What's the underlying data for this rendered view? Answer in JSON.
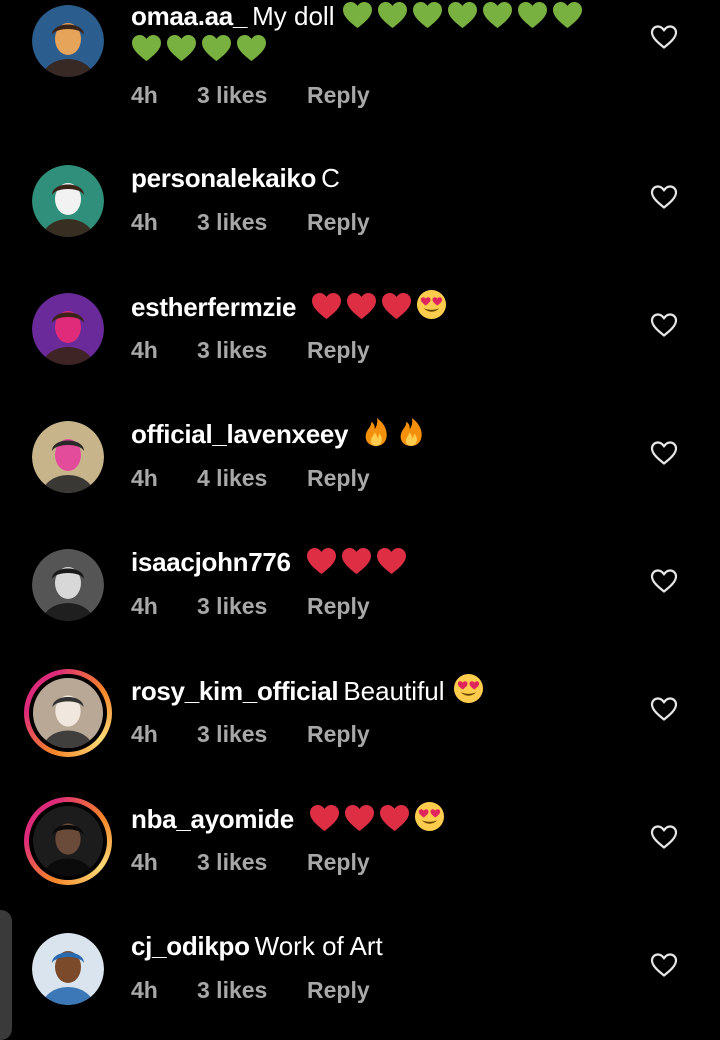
{
  "comments": [
    {
      "username": "omaa.aa_",
      "text": "My doll",
      "emojis": [
        "green-heart",
        "green-heart",
        "green-heart",
        "green-heart",
        "green-heart",
        "green-heart",
        "green-heart",
        "green-heart",
        "green-heart",
        "green-heart",
        "green-heart"
      ],
      "time": "4h",
      "likes": "3 likes",
      "reply": "Reply",
      "story_ring": false,
      "avatar_colors": [
        "#2c5d8f",
        "#e6a45a",
        "#3a2418"
      ]
    },
    {
      "username": "personalekaiko",
      "text": "C",
      "emojis": [],
      "time": "4h",
      "likes": "3 likes",
      "reply": "Reply",
      "story_ring": false,
      "avatar_colors": [
        "#2f8f7a",
        "#f2f2f2",
        "#3a2418"
      ]
    },
    {
      "username": "estherfermzie",
      "text": "",
      "emojis": [
        "red-heart",
        "red-heart",
        "red-heart",
        "heart-eyes-face"
      ],
      "time": "4h",
      "likes": "3 likes",
      "reply": "Reply",
      "story_ring": false,
      "avatar_colors": [
        "#6a2a9a",
        "#e02b7a",
        "#3a2418"
      ]
    },
    {
      "username": "official_lavenxeey",
      "text": "",
      "emojis": [
        "fire",
        "fire"
      ],
      "time": "4h",
      "likes": "4 likes",
      "reply": "Reply",
      "story_ring": false,
      "avatar_colors": [
        "#c8b48a",
        "#e24c9a",
        "#2a2a2a"
      ]
    },
    {
      "username": "isaacjohn776",
      "text": "",
      "emojis": [
        "red-heart",
        "red-heart",
        "red-heart"
      ],
      "time": "4h",
      "likes": "3 likes",
      "reply": "Reply",
      "story_ring": false,
      "avatar_colors": [
        "#555555",
        "#d8d8d8",
        "#1a1a1a"
      ]
    },
    {
      "username": "rosy_kim_official",
      "text": "Beautiful",
      "emojis": [
        "heart-eyes-face"
      ],
      "time": "4h",
      "likes": "3 likes",
      "reply": "Reply",
      "story_ring": true,
      "avatar_colors": [
        "#b9a896",
        "#f0e8de",
        "#333333"
      ]
    },
    {
      "username": "nba_ayomide",
      "text": "",
      "emojis": [
        "red-heart",
        "red-heart",
        "red-heart",
        "heart-eyes-face"
      ],
      "time": "4h",
      "likes": "3 likes",
      "reply": "Reply",
      "story_ring": true,
      "avatar_colors": [
        "#1c1c1c",
        "#6a4a38",
        "#0a0a0a"
      ]
    },
    {
      "username": "cj_odikpo",
      "text": "Work of Art",
      "emojis": [],
      "time": "4h",
      "likes": "3 likes",
      "reply": "Reply",
      "story_ring": false,
      "avatar_colors": [
        "#d9e4ef",
        "#7a4a2a",
        "#2a6ab0"
      ]
    }
  ],
  "colors": {
    "background": "#000000",
    "text": "#ffffff",
    "meta": "#a8a8a8",
    "green_heart": "#78b13f",
    "red_heart": "#dd2e44",
    "emoji_face": "#ffcc4d"
  }
}
